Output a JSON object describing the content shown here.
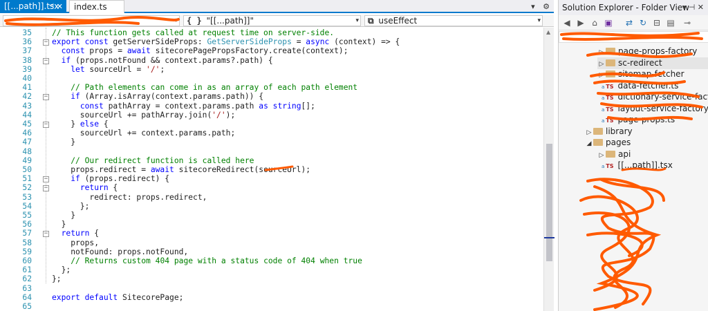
{
  "tabs": [
    {
      "label": "[[...path]].tsx",
      "active": true
    },
    {
      "label": "index.ts",
      "active": false
    }
  ],
  "tabstrip_icons": [
    "dropdown-icon",
    "gear-icon"
  ],
  "navbar": {
    "scope": "",
    "member": "\"[[...path]]\"",
    "member_icon": "{ }",
    "symbol": "useEffect"
  },
  "code_lines": [
    {
      "n": "35",
      "fold": "",
      "html": "<span class=\"cm\">// This function gets called at request time on server-side.</span>"
    },
    {
      "n": "36",
      "fold": "−",
      "html": "<span class=\"kw\">export const</span> getServerSideProps: <span class=\"ty\">GetServerSideProps</span> = <span class=\"kw\">async</span> (context) =&gt; {"
    },
    {
      "n": "37",
      "fold": "",
      "html": "  <span class=\"kw\">const</span> props = <span class=\"kw\">await</span> sitecorePagePropsFactory.create(context);"
    },
    {
      "n": "38",
      "fold": "−",
      "html": "  <span class=\"kw\">if</span> (props.notFound &amp;&amp; context.params?.path) {"
    },
    {
      "n": "39",
      "fold": "",
      "html": "    <span class=\"kw\">let</span> sourceUrl = <span class=\"str\">'/'</span>;"
    },
    {
      "n": "40",
      "fold": "",
      "html": ""
    },
    {
      "n": "41",
      "fold": "",
      "html": "    <span class=\"cm\">// Path elements can come in as an array of each path element</span>"
    },
    {
      "n": "42",
      "fold": "−",
      "html": "    <span class=\"kw\">if</span> (Array.isArray(context.params.path)) {"
    },
    {
      "n": "43",
      "fold": "",
      "html": "      <span class=\"kw\">const</span> pathArray = context.params.path <span class=\"kw\">as string</span>[];"
    },
    {
      "n": "44",
      "fold": "",
      "html": "      sourceUrl += pathArray.join(<span class=\"str\">'/'</span>);"
    },
    {
      "n": "45",
      "fold": "−",
      "html": "    } <span class=\"kw\">else</span> {"
    },
    {
      "n": "46",
      "fold": "",
      "html": "      sourceUrl += context.params.path;"
    },
    {
      "n": "47",
      "fold": "",
      "html": "    }"
    },
    {
      "n": "48",
      "fold": "",
      "html": ""
    },
    {
      "n": "49",
      "fold": "",
      "html": "    <span class=\"cm\">// Our redirect function is called here</span>"
    },
    {
      "n": "50",
      "fold": "",
      "html": "    props.redirect = <span class=\"kw\">await</span> sitecoreRedirect(sourceUrl);"
    },
    {
      "n": "51",
      "fold": "−",
      "html": "    <span class=\"kw\">if</span> (props.redirect) {"
    },
    {
      "n": "52",
      "fold": "−",
      "html": "      <span class=\"kw\">return</span> {"
    },
    {
      "n": "53",
      "fold": "",
      "html": "        redirect: props.redirect,"
    },
    {
      "n": "54",
      "fold": "",
      "html": "      };"
    },
    {
      "n": "55",
      "fold": "",
      "html": "    }"
    },
    {
      "n": "56",
      "fold": "",
      "html": "  }"
    },
    {
      "n": "57",
      "fold": "−",
      "html": "  <span class=\"kw\">return</span> {"
    },
    {
      "n": "58",
      "fold": "",
      "html": "    props,"
    },
    {
      "n": "59",
      "fold": "",
      "html": "    notFound: props.notFound,"
    },
    {
      "n": "60",
      "fold": "",
      "html": "    <span class=\"cm\">// Returns custom 404 page with a status code of 404 when true</span>"
    },
    {
      "n": "61",
      "fold": "",
      "html": "  };"
    },
    {
      "n": "62",
      "fold": "",
      "html": "};"
    },
    {
      "n": "63",
      "fold": "",
      "html": ""
    },
    {
      "n": "64",
      "fold": "",
      "html": "<span class=\"kw\">export default</span> SitecorePage;"
    },
    {
      "n": "65",
      "fold": "",
      "html": ""
    }
  ],
  "solution_explorer": {
    "title": "Solution Explorer - Folder View",
    "toolbar_icons": [
      "back-icon",
      "forward-icon",
      "home-icon",
      "switch-views-icon",
      "sync-icon",
      "refresh-icon",
      "collapse-all-icon",
      "show-all-files-icon",
      "properties-icon"
    ],
    "tree": [
      {
        "label": "page-props-factory",
        "kind": "folder",
        "indent": 56,
        "arrow": "▷",
        "selected": false
      },
      {
        "label": "sc-redirect",
        "kind": "folder",
        "indent": 56,
        "arrow": "▷",
        "selected": true
      },
      {
        "label": "sitemap-fetcher",
        "kind": "folder",
        "indent": 56,
        "arrow": "▷",
        "selected": false
      },
      {
        "label": "data-fetcher.ts",
        "kind": "ts",
        "indent": 62,
        "arrow": "",
        "selected": false
      },
      {
        "label": "dictionary-service-factory.ts",
        "kind": "ts",
        "indent": 62,
        "arrow": "",
        "selected": false
      },
      {
        "label": "layout-service-factory.ts",
        "kind": "ts",
        "indent": 62,
        "arrow": "",
        "selected": false
      },
      {
        "label": "page-props.ts",
        "kind": "ts",
        "indent": 62,
        "arrow": "",
        "selected": false
      },
      {
        "label": "library",
        "kind": "folder",
        "indent": 38,
        "arrow": "▷",
        "selected": false
      },
      {
        "label": "pages",
        "kind": "folder",
        "indent": 38,
        "arrow": "◢",
        "selected": false
      },
      {
        "label": "api",
        "kind": "folder",
        "indent": 56,
        "arrow": "▷",
        "selected": false
      },
      {
        "label": "[[...path]].tsx",
        "kind": "ts",
        "indent": 62,
        "arrow": "",
        "selected": false
      }
    ]
  },
  "colors": {
    "accent": "#007acc",
    "keyword": "#0000ff",
    "type": "#2b91af",
    "string": "#a31515",
    "comment": "#008000",
    "scribble": "#ff5a00"
  }
}
